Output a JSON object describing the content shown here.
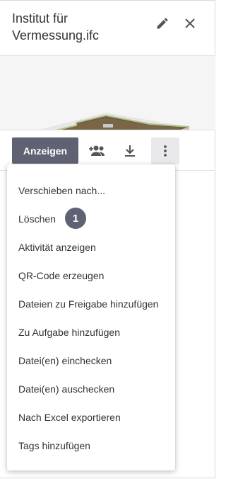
{
  "header": {
    "title": "Institut für Vermessung.ifc",
    "edit_icon": "pencil-icon",
    "close_icon": "close-icon"
  },
  "toolbar": {
    "primary_label": "Anzeigen",
    "share_icon": "add-people-icon",
    "download_icon": "download-icon",
    "more_icon": "more-vertical-icon"
  },
  "menu": {
    "items": [
      {
        "label": "Verschieben nach..."
      },
      {
        "label": "Löschen"
      },
      {
        "label": "Aktivität anzeigen"
      },
      {
        "label": "QR-Code erzeugen"
      },
      {
        "label": "Dateien zu Freigabe hinzufügen"
      },
      {
        "label": "Zu Aufgabe hinzufügen"
      },
      {
        "label": "Datei(en) einchecken"
      },
      {
        "label": "Datei(en) auschecken"
      },
      {
        "label": "Nach Excel exportieren"
      },
      {
        "label": "Tags hinzufügen"
      }
    ],
    "callout_badge": "1"
  },
  "colors": {
    "accent": "#5f6272",
    "text": "#333333"
  }
}
